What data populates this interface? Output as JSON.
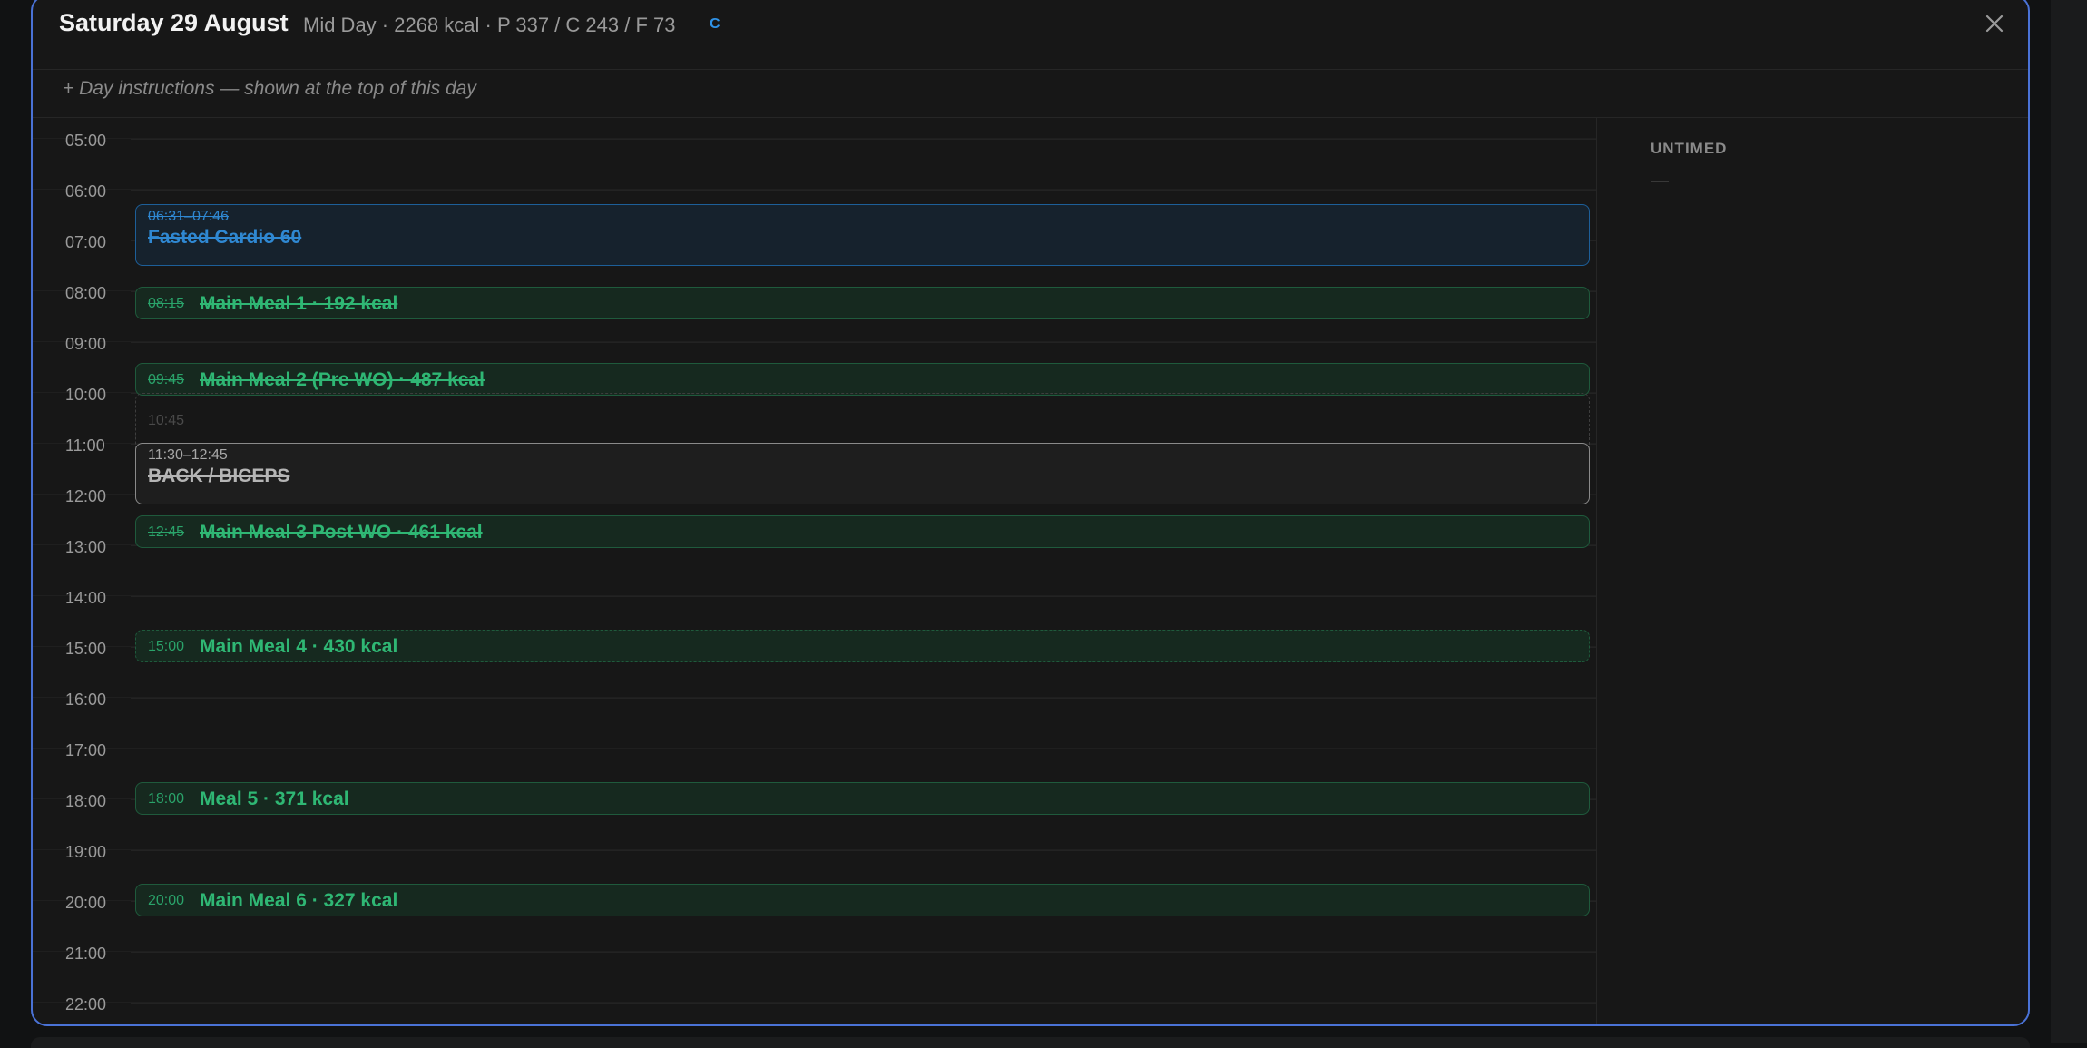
{
  "header": {
    "title": "Saturday 29 August",
    "summary": "Mid Day · 2268 kcal · P 337 / C 243 / F 73",
    "badge": "C"
  },
  "instructions": {
    "placeholder": "+ Day instructions — shown at the top of this day"
  },
  "timeline": {
    "hours": [
      "05:00",
      "06:00",
      "07:00",
      "08:00",
      "09:00",
      "10:00",
      "11:00",
      "12:00",
      "13:00",
      "14:00",
      "15:00",
      "16:00",
      "17:00",
      "18:00",
      "19:00",
      "20:00",
      "21:00",
      "22:00"
    ],
    "events": [
      {
        "type": "cardio",
        "time": "06:31–07:46",
        "title": "Fasted Cardio 60",
        "completed": true
      },
      {
        "type": "meal",
        "time": "08:15",
        "title": "Main Meal 1 · 192 kcal",
        "completed": true
      },
      {
        "type": "meal",
        "time": "09:45",
        "title": "Main Meal 2 (Pre WO) · 487 kcal",
        "completed": true
      },
      {
        "type": "ghost",
        "time": "10:45"
      },
      {
        "type": "workout",
        "time": "11:30–12:45",
        "title": "BACK / BICEPS",
        "completed": true
      },
      {
        "type": "meal",
        "time": "12:45",
        "title": "Main Meal 3 Post WO · 461 kcal",
        "completed": true
      },
      {
        "type": "meal",
        "time": "15:00",
        "title": "Main Meal 4 · 430 kcal",
        "completed": false,
        "planned": true
      },
      {
        "type": "meal",
        "time": "18:00",
        "title": "Meal 5 · 371 kcal",
        "completed": false
      },
      {
        "type": "meal",
        "time": "20:00",
        "title": "Main Meal 6 · 327 kcal",
        "completed": false
      }
    ]
  },
  "untimed": {
    "title": "UNTIMED",
    "empty": "—"
  },
  "colors": {
    "accent": "#4a72d6",
    "meal": "#2fb774",
    "cardio": "#2f88d2",
    "workout": "#b5b5b5"
  },
  "icons": {
    "close": "close-icon"
  }
}
